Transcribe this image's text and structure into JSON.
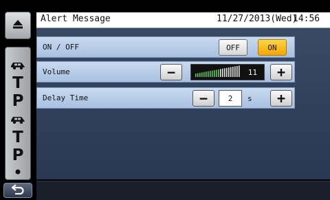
{
  "header": {
    "title": "Alert Message",
    "date": "11/27/2013(Wed)",
    "time": "14:56"
  },
  "settings": {
    "onoff": {
      "label": "ON / OFF",
      "off_label": "OFF",
      "on_label": "ON",
      "selected": "ON"
    },
    "volume": {
      "label": "Volume",
      "minus": "−",
      "plus": "+",
      "value": "11",
      "max": 11
    },
    "delay": {
      "label": "Delay Time",
      "minus": "−",
      "plus": "+",
      "value": "2",
      "unit": "s"
    }
  },
  "sidebar": {
    "items": [
      {
        "icon": "car-icon"
      },
      {
        "letter": "T"
      },
      {
        "letter": "P"
      },
      {
        "icon": "car-icon"
      },
      {
        "letter": "T"
      },
      {
        "letter": "P"
      },
      {
        "icon": "dot-icon"
      }
    ]
  },
  "icons": {
    "top": "eject-icon",
    "back": "back-arrow-icon"
  },
  "colors": {
    "on_accent": "#f3a600",
    "row_bg": "#b9cdea",
    "panel_bg": "#2f3f5a"
  }
}
